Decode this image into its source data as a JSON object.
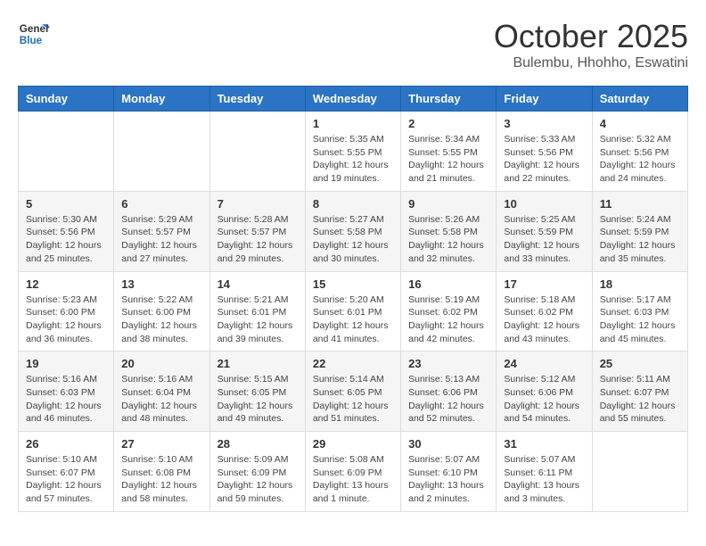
{
  "header": {
    "logo_general": "General",
    "logo_blue": "Blue",
    "month": "October 2025",
    "location": "Bulembu, Hhohho, Eswatini"
  },
  "days_of_week": [
    "Sunday",
    "Monday",
    "Tuesday",
    "Wednesday",
    "Thursday",
    "Friday",
    "Saturday"
  ],
  "weeks": [
    [
      {
        "day": "",
        "info": ""
      },
      {
        "day": "",
        "info": ""
      },
      {
        "day": "",
        "info": ""
      },
      {
        "day": "1",
        "info": "Sunrise: 5:35 AM\nSunset: 5:55 PM\nDaylight: 12 hours\nand 19 minutes."
      },
      {
        "day": "2",
        "info": "Sunrise: 5:34 AM\nSunset: 5:55 PM\nDaylight: 12 hours\nand 21 minutes."
      },
      {
        "day": "3",
        "info": "Sunrise: 5:33 AM\nSunset: 5:56 PM\nDaylight: 12 hours\nand 22 minutes."
      },
      {
        "day": "4",
        "info": "Sunrise: 5:32 AM\nSunset: 5:56 PM\nDaylight: 12 hours\nand 24 minutes."
      }
    ],
    [
      {
        "day": "5",
        "info": "Sunrise: 5:30 AM\nSunset: 5:56 PM\nDaylight: 12 hours\nand 25 minutes."
      },
      {
        "day": "6",
        "info": "Sunrise: 5:29 AM\nSunset: 5:57 PM\nDaylight: 12 hours\nand 27 minutes."
      },
      {
        "day": "7",
        "info": "Sunrise: 5:28 AM\nSunset: 5:57 PM\nDaylight: 12 hours\nand 29 minutes."
      },
      {
        "day": "8",
        "info": "Sunrise: 5:27 AM\nSunset: 5:58 PM\nDaylight: 12 hours\nand 30 minutes."
      },
      {
        "day": "9",
        "info": "Sunrise: 5:26 AM\nSunset: 5:58 PM\nDaylight: 12 hours\nand 32 minutes."
      },
      {
        "day": "10",
        "info": "Sunrise: 5:25 AM\nSunset: 5:59 PM\nDaylight: 12 hours\nand 33 minutes."
      },
      {
        "day": "11",
        "info": "Sunrise: 5:24 AM\nSunset: 5:59 PM\nDaylight: 12 hours\nand 35 minutes."
      }
    ],
    [
      {
        "day": "12",
        "info": "Sunrise: 5:23 AM\nSunset: 6:00 PM\nDaylight: 12 hours\nand 36 minutes."
      },
      {
        "day": "13",
        "info": "Sunrise: 5:22 AM\nSunset: 6:00 PM\nDaylight: 12 hours\nand 38 minutes."
      },
      {
        "day": "14",
        "info": "Sunrise: 5:21 AM\nSunset: 6:01 PM\nDaylight: 12 hours\nand 39 minutes."
      },
      {
        "day": "15",
        "info": "Sunrise: 5:20 AM\nSunset: 6:01 PM\nDaylight: 12 hours\nand 41 minutes."
      },
      {
        "day": "16",
        "info": "Sunrise: 5:19 AM\nSunset: 6:02 PM\nDaylight: 12 hours\nand 42 minutes."
      },
      {
        "day": "17",
        "info": "Sunrise: 5:18 AM\nSunset: 6:02 PM\nDaylight: 12 hours\nand 43 minutes."
      },
      {
        "day": "18",
        "info": "Sunrise: 5:17 AM\nSunset: 6:03 PM\nDaylight: 12 hours\nand 45 minutes."
      }
    ],
    [
      {
        "day": "19",
        "info": "Sunrise: 5:16 AM\nSunset: 6:03 PM\nDaylight: 12 hours\nand 46 minutes."
      },
      {
        "day": "20",
        "info": "Sunrise: 5:16 AM\nSunset: 6:04 PM\nDaylight: 12 hours\nand 48 minutes."
      },
      {
        "day": "21",
        "info": "Sunrise: 5:15 AM\nSunset: 6:05 PM\nDaylight: 12 hours\nand 49 minutes."
      },
      {
        "day": "22",
        "info": "Sunrise: 5:14 AM\nSunset: 6:05 PM\nDaylight: 12 hours\nand 51 minutes."
      },
      {
        "day": "23",
        "info": "Sunrise: 5:13 AM\nSunset: 6:06 PM\nDaylight: 12 hours\nand 52 minutes."
      },
      {
        "day": "24",
        "info": "Sunrise: 5:12 AM\nSunset: 6:06 PM\nDaylight: 12 hours\nand 54 minutes."
      },
      {
        "day": "25",
        "info": "Sunrise: 5:11 AM\nSunset: 6:07 PM\nDaylight: 12 hours\nand 55 minutes."
      }
    ],
    [
      {
        "day": "26",
        "info": "Sunrise: 5:10 AM\nSunset: 6:07 PM\nDaylight: 12 hours\nand 57 minutes."
      },
      {
        "day": "27",
        "info": "Sunrise: 5:10 AM\nSunset: 6:08 PM\nDaylight: 12 hours\nand 58 minutes."
      },
      {
        "day": "28",
        "info": "Sunrise: 5:09 AM\nSunset: 6:09 PM\nDaylight: 12 hours\nand 59 minutes."
      },
      {
        "day": "29",
        "info": "Sunrise: 5:08 AM\nSunset: 6:09 PM\nDaylight: 13 hours\nand 1 minute."
      },
      {
        "day": "30",
        "info": "Sunrise: 5:07 AM\nSunset: 6:10 PM\nDaylight: 13 hours\nand 2 minutes."
      },
      {
        "day": "31",
        "info": "Sunrise: 5:07 AM\nSunset: 6:11 PM\nDaylight: 13 hours\nand 3 minutes."
      },
      {
        "day": "",
        "info": ""
      }
    ]
  ]
}
